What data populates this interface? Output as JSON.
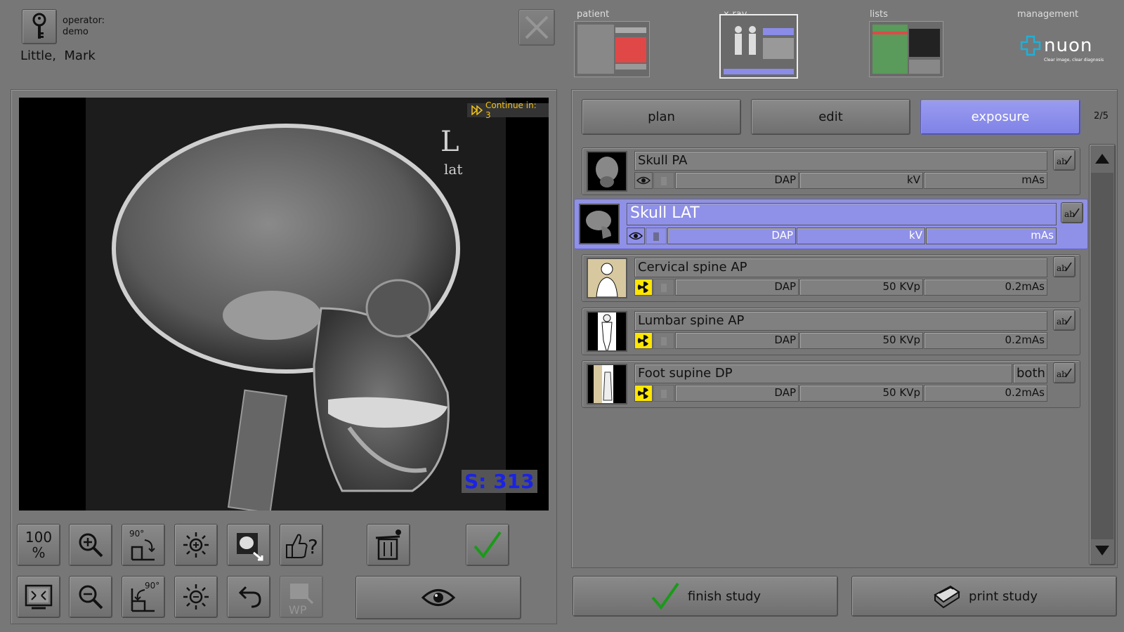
{
  "header": {
    "operator_label": "operator:",
    "operator_name": "demo",
    "patient_name": "Little,  Mark",
    "nav": [
      {
        "label": "patient"
      },
      {
        "label": "x-ray"
      },
      {
        "label": "lists"
      },
      {
        "label": "management"
      }
    ],
    "logo_text": "nuon",
    "logo_tagline": "Clear image, clear diagnosis"
  },
  "viewer": {
    "continue_text": "Continue in: 3",
    "marker_letter": "L",
    "marker_text": "lat",
    "s_value": "S: 313"
  },
  "toolbar": {
    "zoom_100_label": "100\n%",
    "rotate_label": "90°",
    "wp_label": "WP"
  },
  "tabs": {
    "items": [
      {
        "label": "plan"
      },
      {
        "label": "edit"
      },
      {
        "label": "exposure"
      }
    ],
    "page_counter": "2/5"
  },
  "exams": [
    {
      "name": "Skull PA",
      "dap": "DAP",
      "kv": "kV",
      "mas": "mAs",
      "side": ""
    },
    {
      "name": "Skull LAT",
      "dap": "DAP",
      "kv": "kV",
      "mas": "mAs",
      "side": ""
    },
    {
      "name": "Cervical spine AP",
      "dap": "DAP",
      "kv": "50 KVp",
      "mas": "0.2mAs",
      "side": ""
    },
    {
      "name": "Lumbar spine AP",
      "dap": "DAP",
      "kv": "50 KVp",
      "mas": "0.2mAs",
      "side": ""
    },
    {
      "name": "Foot supine DP",
      "dap": "DAP",
      "kv": "50 KVp",
      "mas": "0.2mAs",
      "side": "both"
    }
  ],
  "footer": {
    "finish_label": "finish study",
    "print_label": "print study"
  },
  "colors": {
    "accent": "#8f90e8",
    "background": "#777777",
    "radiation": "#ffe600",
    "check": "#1a9a1a",
    "s_value": "#1a22e6"
  }
}
